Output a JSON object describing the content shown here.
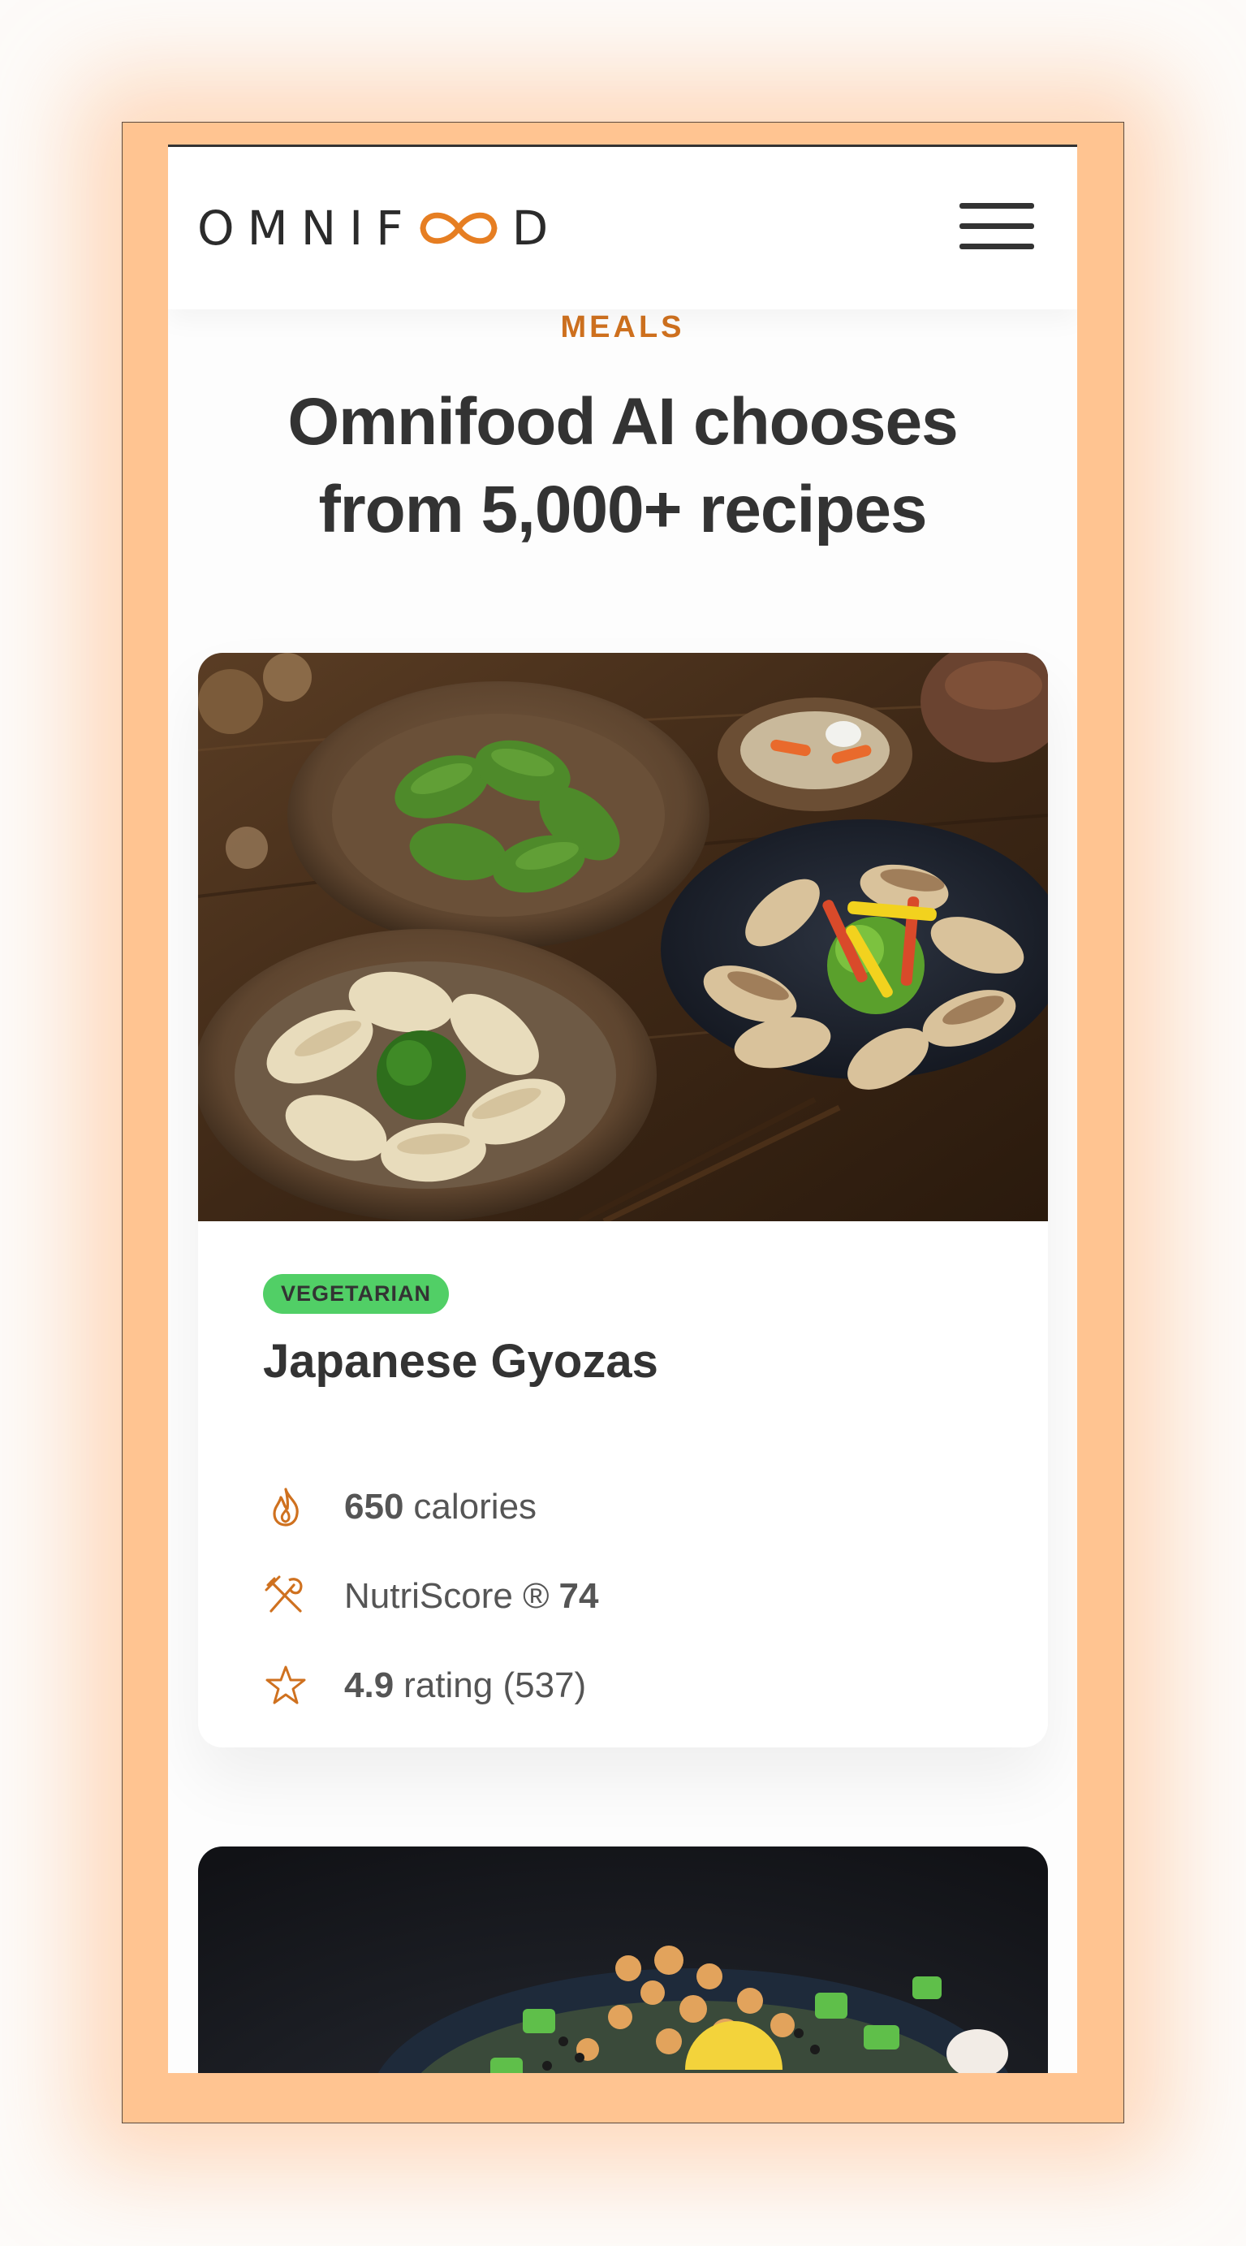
{
  "app": {
    "logo_letters_left": "OMNIF",
    "logo_letters_right": "D",
    "menu_icon": "hamburger-menu-icon"
  },
  "section": {
    "subheading": "MEALS",
    "heading_line1": "Omnifood AI chooses",
    "heading_line2": "from 5,000+ recipes"
  },
  "meals": [
    {
      "tag": "VEGETARIAN",
      "title": "Japanese Gyozas",
      "image_alt": "Japanese Gyozas",
      "calories_value": "650",
      "calories_label": "calories",
      "nutriscore_label": "NutriScore ®",
      "nutriscore_value": "74",
      "rating_value": "4.9",
      "rating_label": "rating (537)"
    },
    {
      "image_alt": "Avocado Salad"
    }
  ],
  "colors": {
    "accent": "#cf711f",
    "frame": "#ffc491",
    "tag_green": "#51cf66",
    "text": "#333333"
  },
  "icons": [
    "flame-icon",
    "restaurant-icon",
    "star-icon"
  ]
}
